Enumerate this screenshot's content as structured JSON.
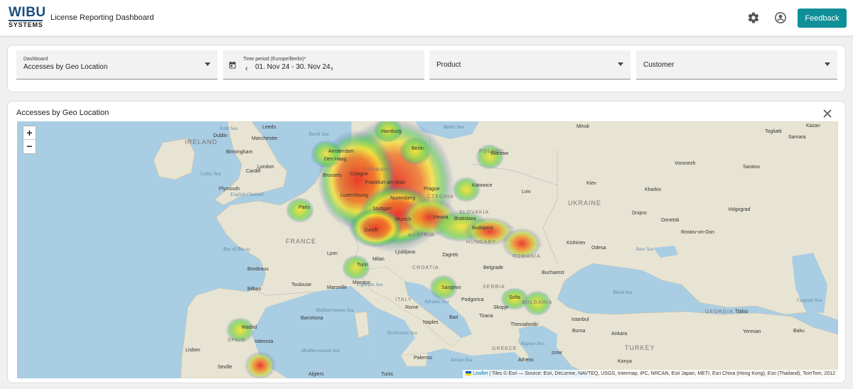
{
  "app": {
    "logo_top": "WIBU",
    "logo_bottom": "SYSTEMS",
    "title": "License Reporting Dashboard",
    "icons": [
      "gear-icon",
      "account-icon"
    ],
    "feedback_label": "Feedback",
    "accent": "#0f8f98"
  },
  "filters": {
    "dashboard": {
      "label": "Dashboard",
      "value": "Accesses by Geo Location"
    },
    "period": {
      "label": "Time period (Europe/Berlin)*",
      "value": "01. Nov 24 - 30. Nov 24"
    },
    "product": {
      "placeholder": "Product"
    },
    "customer": {
      "placeholder": "Customer"
    }
  },
  "panel": {
    "title": "Accesses by Geo Location"
  },
  "map": {
    "zoom_in": "+",
    "zoom_out": "−",
    "attribution_link": "Leaflet",
    "attribution_text": " | Tiles © Esri — Source: Esri, DeLorme, NAVTEQ, USGS, Intermap, iPC, NRCAN, Esri Japan, METI, Esri China (Hong Kong), Esri (Thailand), TomTom, 2012",
    "colors": {
      "sea": "#a9cde3",
      "land": "#e8e4d3",
      "hot": "#e8322a",
      "warm": "#f5e33a",
      "cool": "#58c95b"
    },
    "seas": [
      "Irish Sea",
      "Celtic Sea",
      "English Channel",
      "Bay of Biscay",
      "North Sea",
      "Baltic Sea",
      "Adriatic Sea",
      "Tyrrhenian Sea",
      "Ionian Sea",
      "Mediterranean Sea",
      "Mediterranean Sea",
      "Ligurian Sea",
      "Black Sea",
      "Azov Sea",
      "Caspian Sea",
      "Aegean Sea"
    ],
    "countries": [
      "IRELAND",
      "FRANCE",
      "SPAIN",
      "GERMANY",
      "POLAND",
      "CZECHIA",
      "SLOVAKIA",
      "AUSTRIA",
      "HUNGARY",
      "ROMANIA",
      "CROATIA",
      "SERBIA",
      "BULGARIA",
      "ITALY",
      "GREECE",
      "TURKEY",
      "UKRAINE",
      "GEORGIA"
    ],
    "cities": [
      "Leeds",
      "Dublin",
      "Manchester",
      "Birmingham",
      "Cardiff",
      "London",
      "Plymouth",
      "Amsterdam",
      "Den Haag",
      "Brussels",
      "Cologne",
      "Frankfurt am Main",
      "Luxembourg",
      "Stuttgart",
      "Munich",
      "Nuremberg",
      "Hamburg",
      "Berlin",
      "Prague",
      "Warsaw",
      "Katowice",
      "Vienna",
      "Bratislava",
      "Budapest",
      "Zurich",
      "Paris",
      "Lyon",
      "Turin",
      "Milan",
      "Monaco",
      "Marseille",
      "Toulouse",
      "Bordeaux",
      "Bilbao",
      "Madrid",
      "Valencia",
      "Barcelona",
      "Lisbon",
      "Seville",
      "Algiers",
      "Tunis",
      "Palermo",
      "Rome",
      "Naples",
      "Bari",
      "Ljubljana",
      "Zagreb",
      "Sarajevo",
      "Belgrade",
      "Podgorica",
      "Tirana",
      "Skopje",
      "Sofia",
      "Thessaloniki",
      "Athens",
      "Izmir",
      "Bucharest",
      "Kishinev",
      "Odesa",
      "Lviv",
      "Kiev",
      "Minsk",
      "Kharkiv",
      "Dnipro",
      "Donetsk",
      "Voronezh",
      "Saratov",
      "Volgograd",
      "Rostov-on-Don",
      "Istanbul",
      "Bursa",
      "Ankara",
      "Konya",
      "Tbilisi",
      "Yerevan",
      "Baku",
      "Togliatti",
      "Samara",
      "Kazan"
    ]
  }
}
